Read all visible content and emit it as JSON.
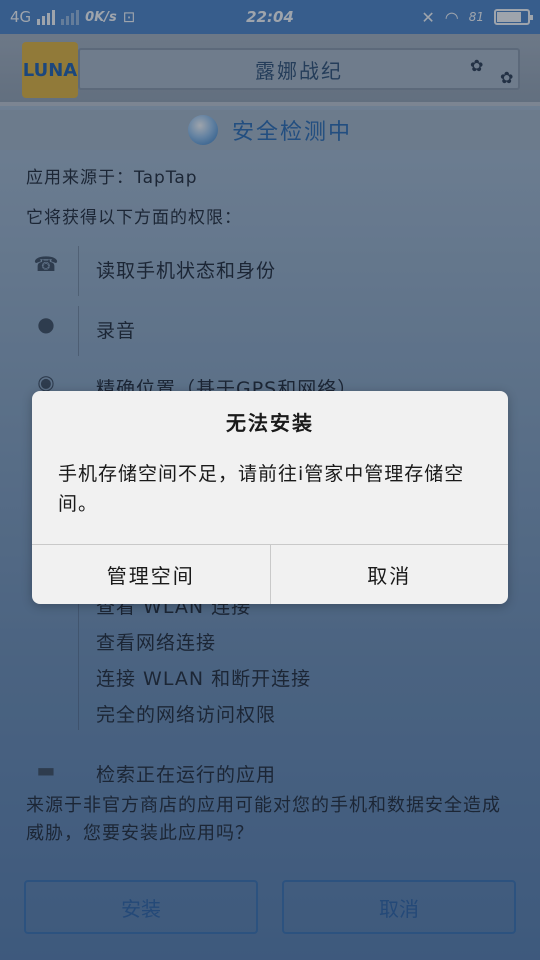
{
  "status_bar": {
    "network": "4G",
    "speed": "0K/s",
    "time": "22:04",
    "battery": "81",
    "battery_level": 0.81
  },
  "app": {
    "logo_text": "LUNA",
    "title": "露娜战纪",
    "scan_status": "安全检测中"
  },
  "install_info": {
    "source": "应用来源于：TapTap",
    "permissions_heading": "它将获得以下方面的权限：",
    "permissions": [
      {
        "icon": "phone-icon",
        "label": "读取手机状态和身份"
      },
      {
        "icon": "microphone-icon",
        "label": "录音"
      },
      {
        "icon": "location-icon",
        "label": "精确位置（基于GPS和网络）"
      }
    ],
    "network_permissions": [
      "查看 WLAN 连接",
      "查看网络连接",
      "连接 WLAN 和断开连接",
      "完全的网络访问权限"
    ],
    "running_apps_permission": "检索正在运行的应用",
    "warning": "来源于非官方商店的应用可能对您的手机和数据安全造成威胁，您要安装此应用吗？",
    "install_button": "安装",
    "cancel_button": "取消"
  },
  "dialog": {
    "title": "无法安装",
    "message": "手机存储空间不足，请前往i管家中管理存储空间。",
    "manage_button": "管理空间",
    "cancel_button": "取消"
  }
}
